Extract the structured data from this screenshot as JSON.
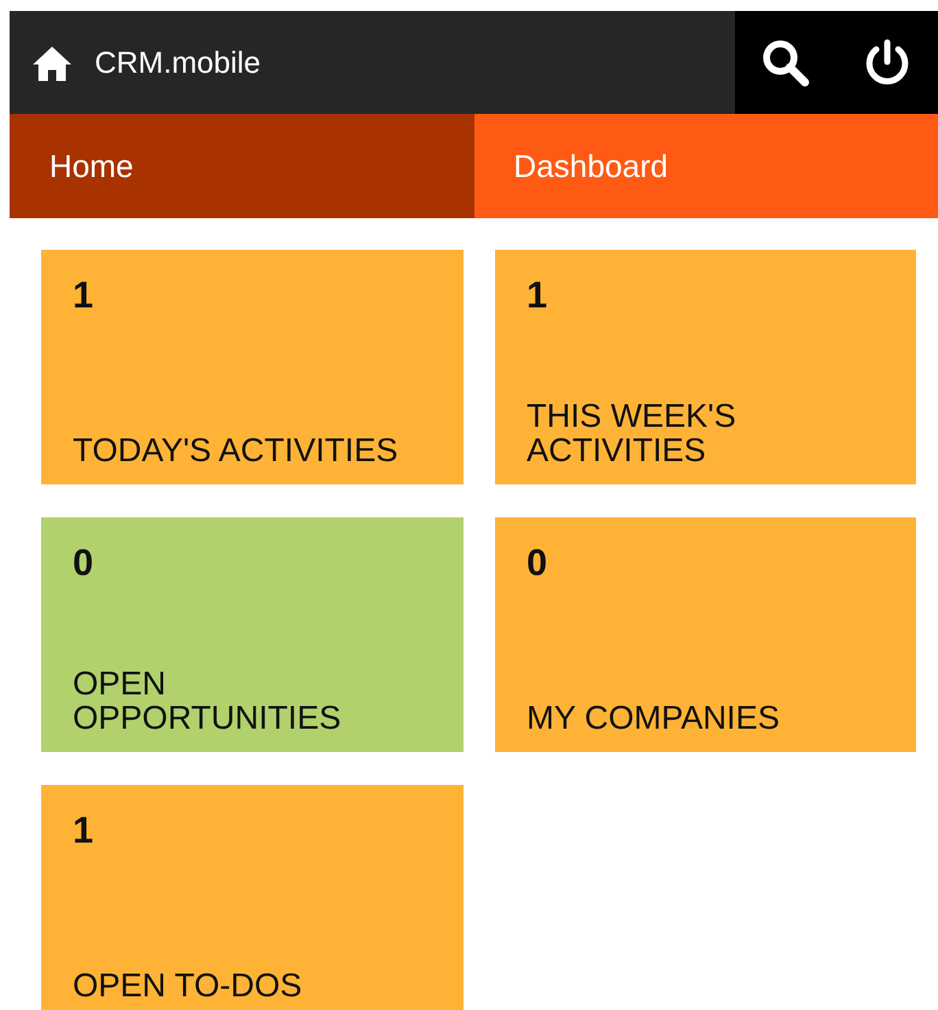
{
  "app_bar": {
    "title": "CRM.mobile"
  },
  "tabs": [
    {
      "label": "Home",
      "selected": true
    },
    {
      "label": "Dashboard",
      "selected": false
    }
  ],
  "tiles": [
    {
      "count": "1",
      "label": "TODAY'S ACTIVITIES",
      "color": "#ffb336"
    },
    {
      "count": "1",
      "label": "THIS WEEK'S ACTIVITIES",
      "color": "#ffb336"
    },
    {
      "count": "0",
      "label": "OPEN OPPORTUNITIES",
      "color": "#b0d16b"
    },
    {
      "count": "0",
      "label": "MY COMPANIES",
      "color": "#ffb336"
    },
    {
      "count": "1",
      "label": "OPEN TO-DOS",
      "color": "#ffb336"
    }
  ]
}
